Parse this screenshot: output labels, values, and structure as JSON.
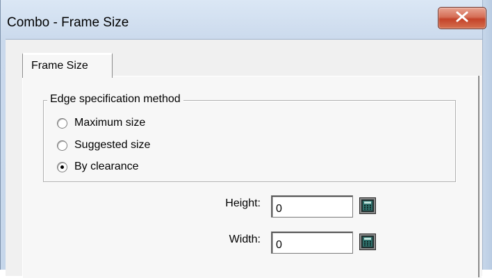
{
  "window": {
    "title": "Combo - Frame Size",
    "close_icon": "close-icon"
  },
  "tabs": [
    {
      "label": "Frame Size",
      "selected": true
    }
  ],
  "group": {
    "legend": "Edge specification method",
    "options": [
      {
        "label": "Maximum size",
        "checked": false
      },
      {
        "label": "Suggested size",
        "checked": false
      },
      {
        "label": "By clearance",
        "checked": true
      }
    ]
  },
  "fields": {
    "height": {
      "label": "Height:",
      "value": "0",
      "button_icon": "calculator-icon"
    },
    "width": {
      "label": "Width:",
      "value": "0",
      "button_icon": "calculator-icon"
    }
  },
  "colors": {
    "close_button": "#c4432a",
    "titlebar": "#dbe7f5",
    "panel": "#f7f7f7"
  }
}
